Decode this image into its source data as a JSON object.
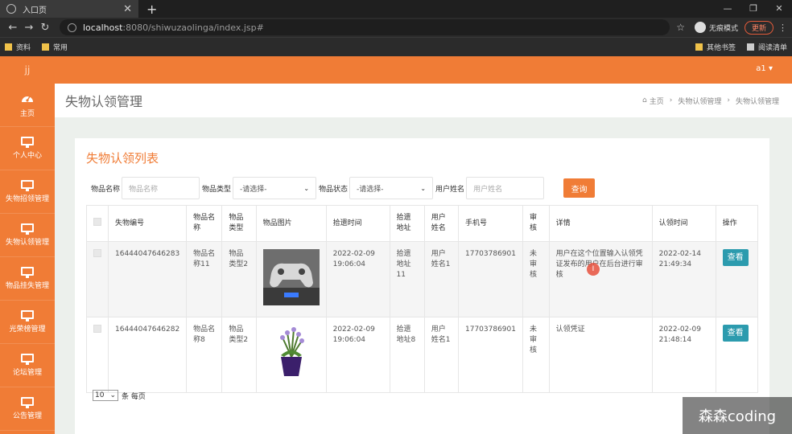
{
  "browser": {
    "tab_title": "入口页",
    "close": "✕",
    "new_tab": "+",
    "url_host": "localhost",
    "url_rest": ":8080/shiwuzaolinga/index.jsp#",
    "incognito": "无痕模式",
    "update": "更新",
    "bookmarks": [
      "资料",
      "常用"
    ],
    "bookmarks_right": [
      "其他书签",
      "阅读清单"
    ]
  },
  "topbar": {
    "user": "a1 ▾"
  },
  "sidebar": {
    "logo": "jj",
    "items": [
      {
        "label": "主页",
        "icon": "gauge-icon"
      },
      {
        "label": "个人中心",
        "icon": "monitor-icon"
      },
      {
        "label": "失物招领管理",
        "icon": "monitor-icon"
      },
      {
        "label": "失物认领管理",
        "icon": "monitor-icon"
      },
      {
        "label": "物品挂失管理",
        "icon": "monitor-icon"
      },
      {
        "label": "光荣榜管理",
        "icon": "monitor-icon"
      },
      {
        "label": "论坛管理",
        "icon": "monitor-icon"
      },
      {
        "label": "公告管理",
        "icon": "monitor-icon"
      }
    ]
  },
  "header": {
    "title": "失物认领管理",
    "breadcrumb": [
      "主页",
      "失物认领管理",
      "失物认领管理"
    ]
  },
  "card": {
    "title": "失物认领列表"
  },
  "search": {
    "name_label": "物品名称",
    "name_placeholder": "物品名称",
    "type_label": "物品类型",
    "type_value": "-请选择-",
    "status_label": "物品状态",
    "status_value": "-请选择-",
    "user_label": "用户姓名",
    "user_placeholder": "用户姓名",
    "query": "查询"
  },
  "table": {
    "headers": [
      "失物编号",
      "物品名称",
      "物品类型",
      "物品图片",
      "拾遗时间",
      "拾遗地址",
      "用户姓名",
      "手机号",
      "审核",
      "详情",
      "认领时间",
      "操作"
    ],
    "rows": [
      {
        "id": "16444047646283",
        "name": "物品名称11",
        "type": "物品类型2",
        "pick_time": "2022-02-09 19:06:04",
        "address": "拾遗地址11",
        "user": "用户姓名1",
        "phone": "17703786901",
        "audit": "未审核",
        "detail": "用户在这个位置输入认领凭证发布的用户在后台进行审核",
        "claim_time": "2022-02-14 21:49:34",
        "action": "查看",
        "image": "gamepad-photo"
      },
      {
        "id": "16444047646282",
        "name": "物品名称8",
        "type": "物品类型2",
        "pick_time": "2022-02-09 19:06:04",
        "address": "拾遗地址8",
        "user": "用户姓名1",
        "phone": "17703786901",
        "audit": "未审核",
        "detail": "认领凭证",
        "claim_time": "2022-02-09 21:48:14",
        "action": "查看",
        "image": "potted-lavender-photo"
      }
    ]
  },
  "pager": {
    "page_size": "10",
    "suffix": "条 每页"
  },
  "cursor_mark": "I",
  "watermark": "森森coding"
}
